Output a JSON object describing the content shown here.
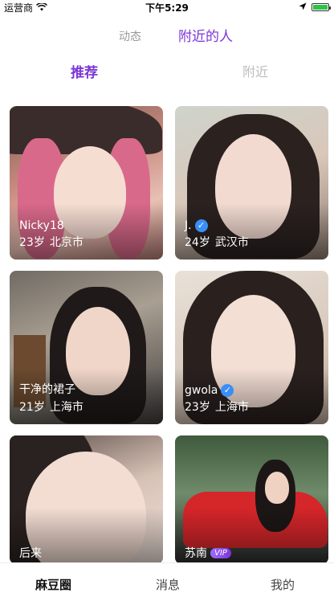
{
  "status_bar": {
    "carrier": "运营商",
    "time": "下午5:29",
    "battery_level_percent": 100
  },
  "top_tabs": [
    {
      "label": "动态",
      "active": false
    },
    {
      "label": "附近的人",
      "active": true
    }
  ],
  "sub_tabs": [
    {
      "label": "推荐",
      "active": true
    },
    {
      "label": "附近",
      "active": false
    }
  ],
  "users": [
    {
      "name": "Nicky18",
      "age": "23岁",
      "city": "北京市",
      "verified": false,
      "vip": false
    },
    {
      "name": "J.",
      "age": "24岁",
      "city": "武汉市",
      "verified": true,
      "vip": false
    },
    {
      "name": "干净的裙子",
      "age": "21岁",
      "city": "上海市",
      "verified": false,
      "vip": false
    },
    {
      "name": "gwola",
      "age": "23岁",
      "city": "上海市",
      "verified": true,
      "vip": false
    },
    {
      "name": "后来",
      "age": "",
      "city": "",
      "verified": false,
      "vip": false
    },
    {
      "name": "苏南",
      "age": "",
      "city": "",
      "verified": false,
      "vip": true,
      "vip_label": "VIP"
    }
  ],
  "bottom_tabs": [
    {
      "label": "麻豆圈",
      "active": true
    },
    {
      "label": "消息",
      "active": false
    },
    {
      "label": "我的",
      "active": false
    }
  ],
  "colors": {
    "accent": "#7b36d6",
    "inactive": "#9a9a9a",
    "verified": "#3a8ef6"
  },
  "icons": {
    "wifi": "wifi-icon",
    "location": "location-arrow-icon",
    "battery": "battery-icon",
    "verified": "verified-check-icon"
  }
}
